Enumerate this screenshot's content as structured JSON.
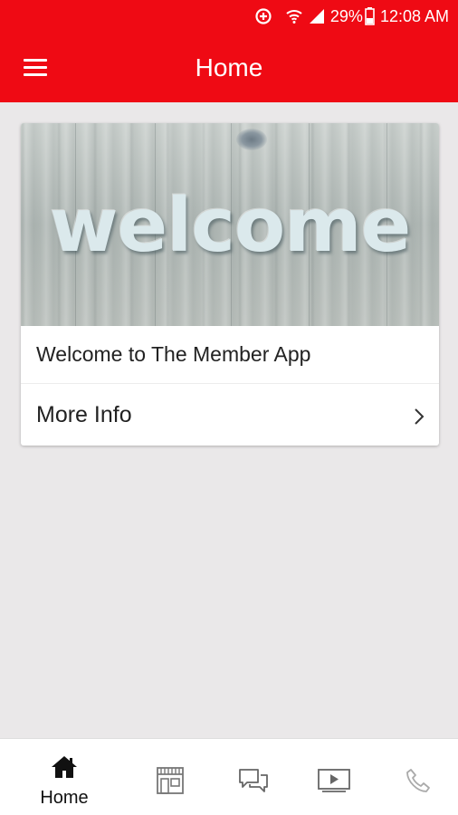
{
  "status_bar": {
    "battery_percent": "29%",
    "time": "12:08 AM",
    "icons": [
      "data-saver-icon",
      "wifi-icon",
      "signal-icon",
      "battery-icon"
    ]
  },
  "app_bar": {
    "title": "Home",
    "menu_icon": "hamburger-menu-icon",
    "background": "#ef0a14"
  },
  "card": {
    "image_text": "welcome",
    "caption": "Welcome to The Member App",
    "link_label": "More Info",
    "link_icon": "chevron-right-icon"
  },
  "bottom_nav": {
    "items": [
      {
        "icon": "home-icon",
        "label": "Home",
        "active": true
      },
      {
        "icon": "store-icon",
        "label": "",
        "active": false
      },
      {
        "icon": "chat-icon",
        "label": "",
        "active": false
      },
      {
        "icon": "video-icon",
        "label": "",
        "active": false
      },
      {
        "icon": "phone-icon",
        "label": "",
        "active": false
      }
    ]
  }
}
